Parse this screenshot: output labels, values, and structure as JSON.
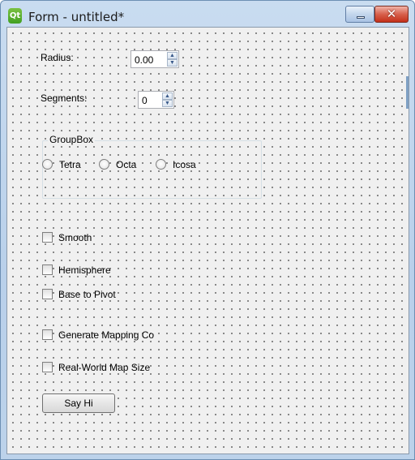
{
  "window": {
    "title": "Form - untitled*",
    "app_icon": "qt-logo-icon",
    "controls": {
      "minimize": "minimize-icon",
      "close": "close-icon",
      "close_glyph": "✕"
    }
  },
  "form": {
    "radius": {
      "label": "Radius:",
      "value": "0.00"
    },
    "segments": {
      "label": "Segments:",
      "value": "0"
    },
    "groupbox": {
      "title": "GroupBox",
      "options": [
        "Tetra",
        "Octa",
        "Icosa"
      ]
    },
    "checkboxes": {
      "smooth": "Smooth",
      "hemisphere": "Hemisphere",
      "base_to_pivot": "Base to Pivot",
      "generate_mapping": "Generate Mapping Co",
      "real_world": "Real-World Map Size"
    },
    "button": "Say Hi"
  },
  "colors": {
    "title_bar": "#c9dcf0",
    "close_button": "#c4301a",
    "canvas_bg": "#f0f0f0"
  }
}
